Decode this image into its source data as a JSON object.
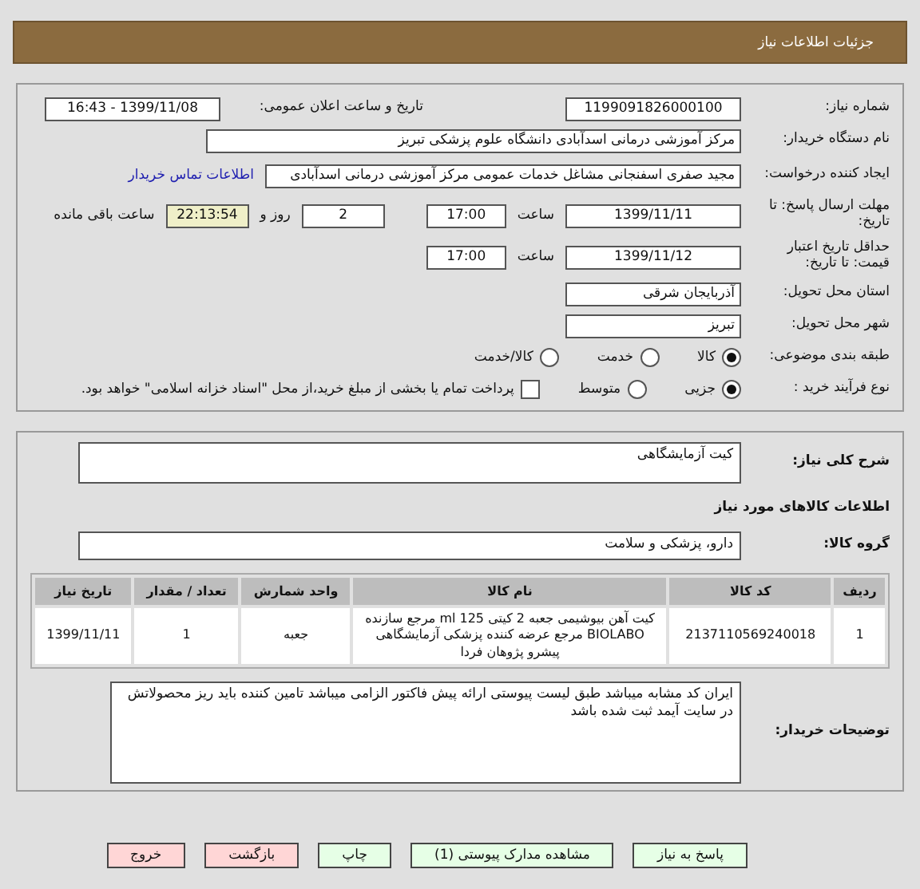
{
  "header": {
    "title": "جزئیات اطلاعات نیاز"
  },
  "need_number": {
    "label": "شماره نیاز:",
    "value": "1199091826000100"
  },
  "announce": {
    "label": "تاریخ و ساعت اعلان عمومی:",
    "value": "1399/11/08 - 16:43"
  },
  "buyer": {
    "label": "نام دستگاه خریدار:",
    "value": "مرکز آموزشی درمانی اسدآبادی دانشگاه علوم پزشکی تبریز"
  },
  "creator": {
    "label": "ایجاد کننده درخواست:",
    "value": "مجید  صفری اسفنجانی مشاغل خدمات عمومی مرکز آموزشی درمانی اسدآبادی",
    "link": "اطلاعات تماس خریدار"
  },
  "deadline": {
    "label": "مهلت ارسال پاسخ: تا تاریخ:",
    "date": "1399/11/11",
    "time_label": "ساعت",
    "time": "17:00",
    "days": "2",
    "days_label": "روز و",
    "remaining": "22:13:54",
    "remaining_label": "ساعت باقی مانده"
  },
  "validity": {
    "label": "حداقل تاریخ اعتبار قیمت: تا تاریخ:",
    "date": "1399/11/12",
    "time_label": "ساعت",
    "time": "17:00"
  },
  "province": {
    "label": "استان محل تحویل:",
    "value": "آذربایجان شرقی"
  },
  "city": {
    "label": "شهر محل تحویل:",
    "value": "تبریز"
  },
  "category": {
    "label": "طبقه بندی موضوعی:",
    "options": [
      {
        "label": "کالا",
        "selected": true
      },
      {
        "label": "خدمت",
        "selected": false
      },
      {
        "label": "کالا/خدمت",
        "selected": false
      }
    ]
  },
  "process": {
    "label": "نوع فرآیند خرید :",
    "options": [
      {
        "label": "جزیی",
        "selected": true
      },
      {
        "label": "متوسط",
        "selected": false
      }
    ],
    "treasury": {
      "label": "پرداخت تمام یا بخشی از مبلغ خرید،از محل \"اسناد خزانه اسلامی\" خواهد بود.",
      "checked": false
    }
  },
  "summary": {
    "label": "شرح کلی نیاز:",
    "value": "کیت آزمایشگاهی"
  },
  "goods_title": "اطلاعات کالاهای مورد نیاز",
  "goods_group": {
    "label": "گروه کالا:",
    "value": "دارو، پزشکی و سلامت"
  },
  "table": {
    "columns": [
      "ردیف",
      "کد کالا",
      "نام کالا",
      "واحد شمارش",
      "تعداد / مقدار",
      "تاریخ نیاز"
    ],
    "rows": [
      [
        "1",
        "2137110569240018",
        "کیت آهن بیوشیمی جعبه 2 کیتی 125 ml مرجع سازنده BIOLABO مرجع عرضه کننده پزشکی آزمایشگاهی پیشرو پژوهان فردا",
        "جعبه",
        "1",
        "1399/11/11"
      ]
    ]
  },
  "notes": {
    "label": "توضیحات خریدار:",
    "value": "ایران کد مشابه میباشد طبق لیست پیوستی ارائه پیش فاکتور الزامی میباشد تامین کننده باید ریز محصولاتش در سایت آیمد ثبت شده باشد"
  },
  "buttons": [
    {
      "label": "پاسخ به نیاز",
      "kind": "action"
    },
    {
      "label": "مشاهده مدارک پیوستی (1)",
      "kind": "action"
    },
    {
      "label": "چاپ",
      "kind": "action"
    },
    {
      "label": "بازگشت",
      "kind": "leave"
    },
    {
      "label": "خروج",
      "kind": "leave"
    }
  ]
}
